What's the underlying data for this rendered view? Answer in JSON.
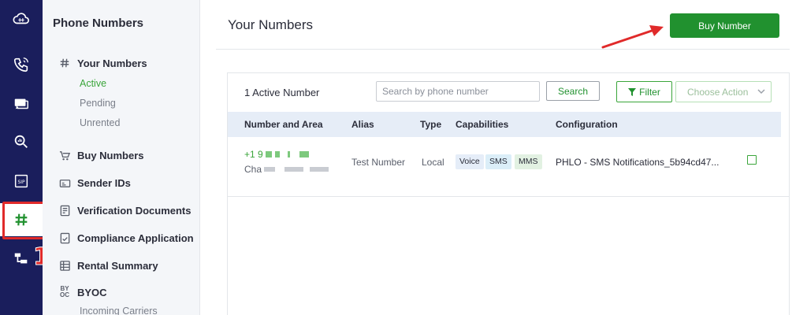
{
  "rail": {
    "icons": [
      "cloud-grid-icon",
      "phone-signal-icon",
      "messages-icon",
      "search-analytics-icon",
      "sip-icon",
      "hash-icon",
      "flow-icon"
    ],
    "annotation_number": "1"
  },
  "subnav": {
    "title": "Phone Numbers",
    "your_numbers": "Your Numbers",
    "active": "Active",
    "pending": "Pending",
    "unrented": "Unrented",
    "buy_numbers": "Buy Numbers",
    "sender_ids": "Sender IDs",
    "verification_documents": "Verification Documents",
    "compliance_application": "Compliance Application",
    "rental_summary": "Rental Summary",
    "byoc": "BYOC",
    "byoc_icon_text": "BY OC",
    "incoming_carriers": "Incoming Carriers"
  },
  "header": {
    "title": "Your Numbers",
    "buy_button": "Buy Number"
  },
  "toolbar": {
    "active_count": "1 Active Number",
    "search_placeholder": "Search by phone number",
    "search_button": "Search",
    "filter_button": "Filter",
    "action_select": "Choose Action"
  },
  "table": {
    "columns": [
      "Number and Area",
      "Alias",
      "Type",
      "Capabilities",
      "Configuration"
    ],
    "rows": [
      {
        "number_prefix": "+1 9",
        "area_prefix": "Cha",
        "alias": "Test Number",
        "type": "Local",
        "capabilities": [
          "Voice",
          "SMS",
          "MMS"
        ],
        "configuration": "PHLO - SMS Notifications_5b94cd47..."
      }
    ]
  },
  "colors": {
    "rail": "#1a1e5c",
    "accent_green": "#21912f",
    "annotation_red": "#e02a2a",
    "header_row": "#e6edf7"
  }
}
